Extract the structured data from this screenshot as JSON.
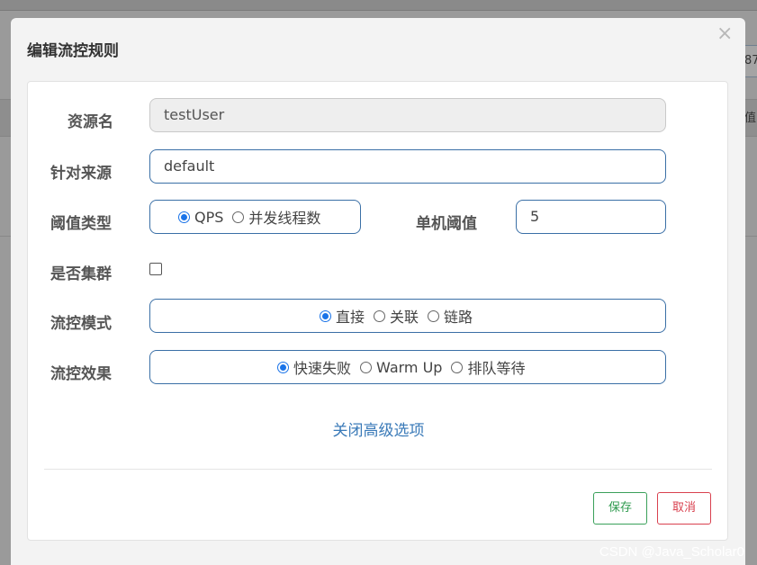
{
  "background": {
    "peek_text": "87",
    "peek_text_2": "值"
  },
  "modal": {
    "title": "编辑流控规则",
    "close_glyph": "×"
  },
  "form": {
    "resource": {
      "label": "资源名",
      "value": "testUser"
    },
    "source": {
      "label": "针对来源",
      "value": "default"
    },
    "threshold_type": {
      "label": "阈值类型",
      "options": [
        "QPS",
        "并发线程数"
      ],
      "selected": "QPS"
    },
    "single_threshold": {
      "label": "单机阈值",
      "value": "5"
    },
    "cluster": {
      "label": "是否集群",
      "checked": false
    },
    "flow_mode": {
      "label": "流控模式",
      "options": [
        "直接",
        "关联",
        "链路"
      ],
      "selected": "直接"
    },
    "flow_effect": {
      "label": "流控效果",
      "options": [
        "快速失败",
        "Warm Up",
        "排队等待"
      ],
      "selected": "快速失败"
    },
    "advanced_link": "关闭高级选项"
  },
  "footer": {
    "save_label": "保存",
    "cancel_label": "取消"
  },
  "watermark": "CSDN @Java_Scholar0",
  "colors": {
    "primary": "#3a6fa6",
    "radio_selected": "#1a73e8",
    "save": "#2e9a4e",
    "cancel": "#d9414f",
    "link": "#3a7ab8"
  }
}
